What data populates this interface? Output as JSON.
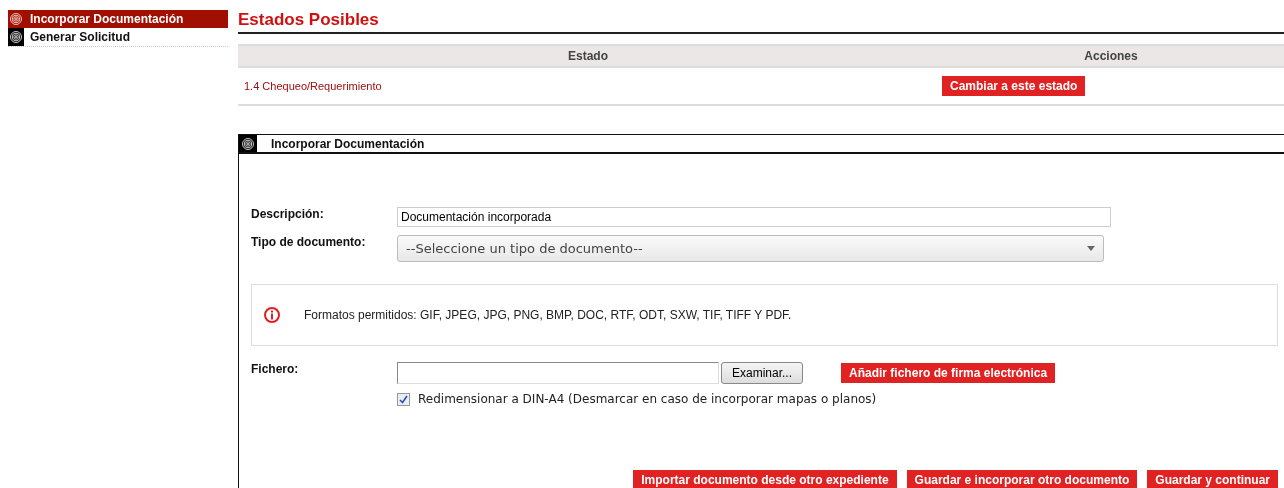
{
  "sidebar": {
    "items": [
      {
        "label": "Incorporar Documentación",
        "selected": true
      },
      {
        "label": "Generar Solicitud",
        "selected": false
      }
    ]
  },
  "states": {
    "title": "Estados Posibles",
    "columns": [
      "Estado",
      "Acciones"
    ],
    "rows": [
      {
        "state": "1.4 Chequeo/Requerimiento",
        "action": "Cambiar a este estado"
      }
    ]
  },
  "panel": {
    "title": "Incorporar Documentación",
    "description": {
      "label": "Descripción:",
      "value": "Documentación incorporada"
    },
    "document_type": {
      "label": "Tipo de documento:",
      "value": "--Seleccione un tipo de documento--"
    },
    "info": "Formatos permitidos: GIF, JPEG, JPG, PNG, BMP, DOC, RTF, ODT, SXW, TIF, TIFF Y PDF.",
    "file": {
      "label": "Fichero:",
      "browse": "Examinar...",
      "signature_button": "Añadir fichero de firma electrónica"
    },
    "resize": {
      "label": "Redimensionar a DIN-A4 (Desmarcar en caso de incorporar mapas o planos)",
      "checked": true
    },
    "buttons": [
      "Importar documento desde otro expediente",
      "Guardar e incorporar otro documento",
      "Guardar y continuar"
    ]
  }
}
